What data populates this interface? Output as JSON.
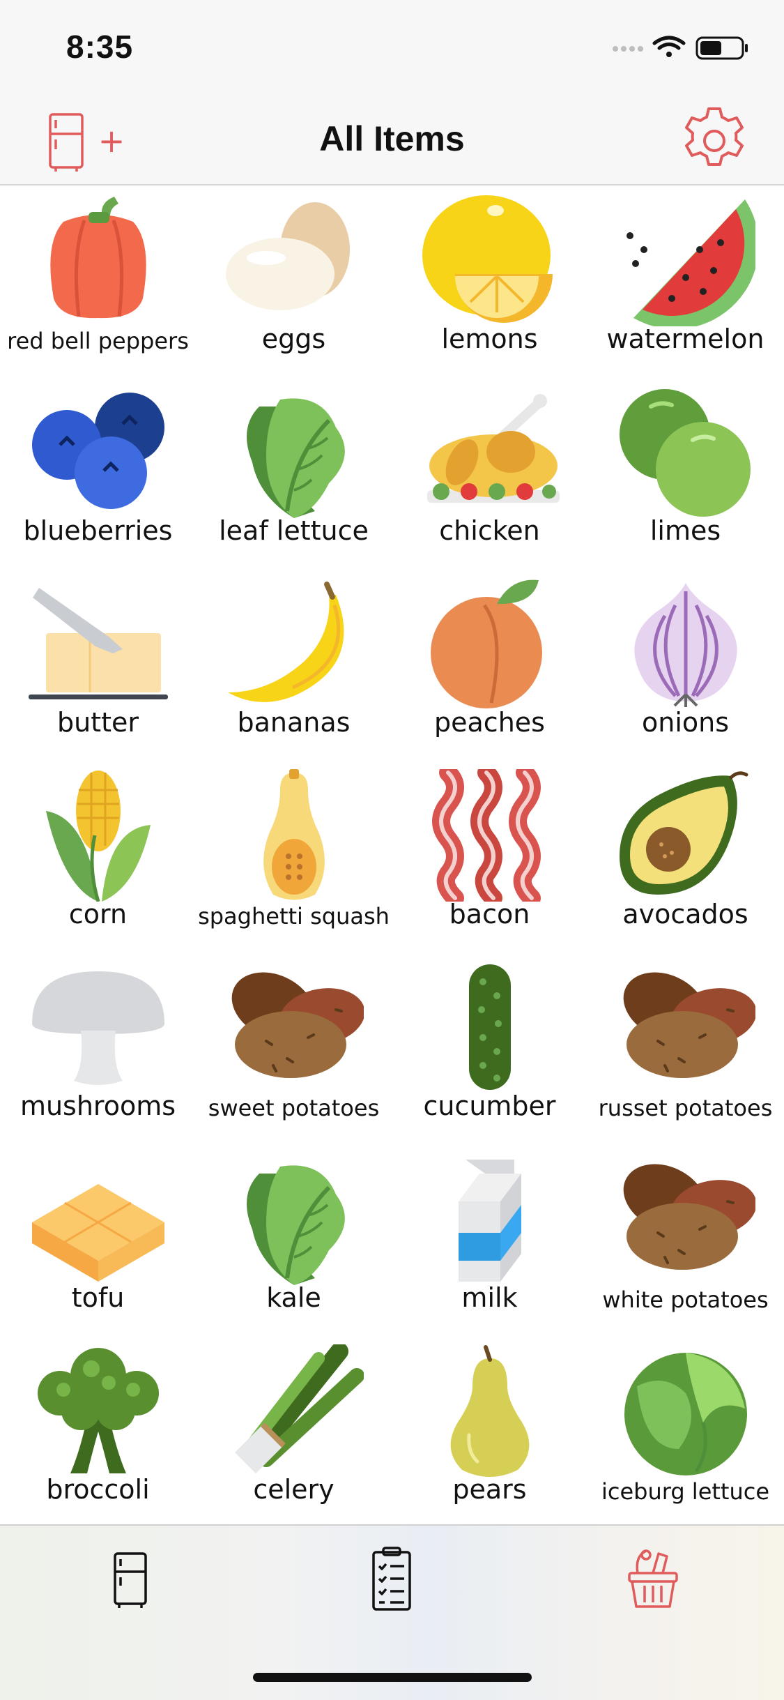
{
  "status": {
    "time": "8:35"
  },
  "nav": {
    "title": "All Items",
    "add_symbol": "+"
  },
  "colors": {
    "accent": "#e05b5b",
    "nav_bg": "#f7f7f7"
  },
  "icons": {
    "nav_left": "fridge-plus-icon",
    "nav_right": "gear-icon",
    "tab_fridge": "fridge-icon",
    "tab_list": "checklist-icon",
    "tab_basket": "basket-icon"
  },
  "items": [
    "red bell peppers",
    "eggs",
    "lemons",
    "watermelon",
    "blueberries",
    "leaf lettuce",
    "chicken",
    "limes",
    "butter",
    "bananas",
    "peaches",
    "onions",
    "corn",
    "spaghetti squash",
    "bacon",
    "avocados",
    "mushrooms",
    "sweet potatoes",
    "cucumber",
    "russet potatoes",
    "tofu",
    "kale",
    "milk",
    "white potatoes",
    "broccoli",
    "celery",
    "pears",
    "iceburg lettuce"
  ]
}
